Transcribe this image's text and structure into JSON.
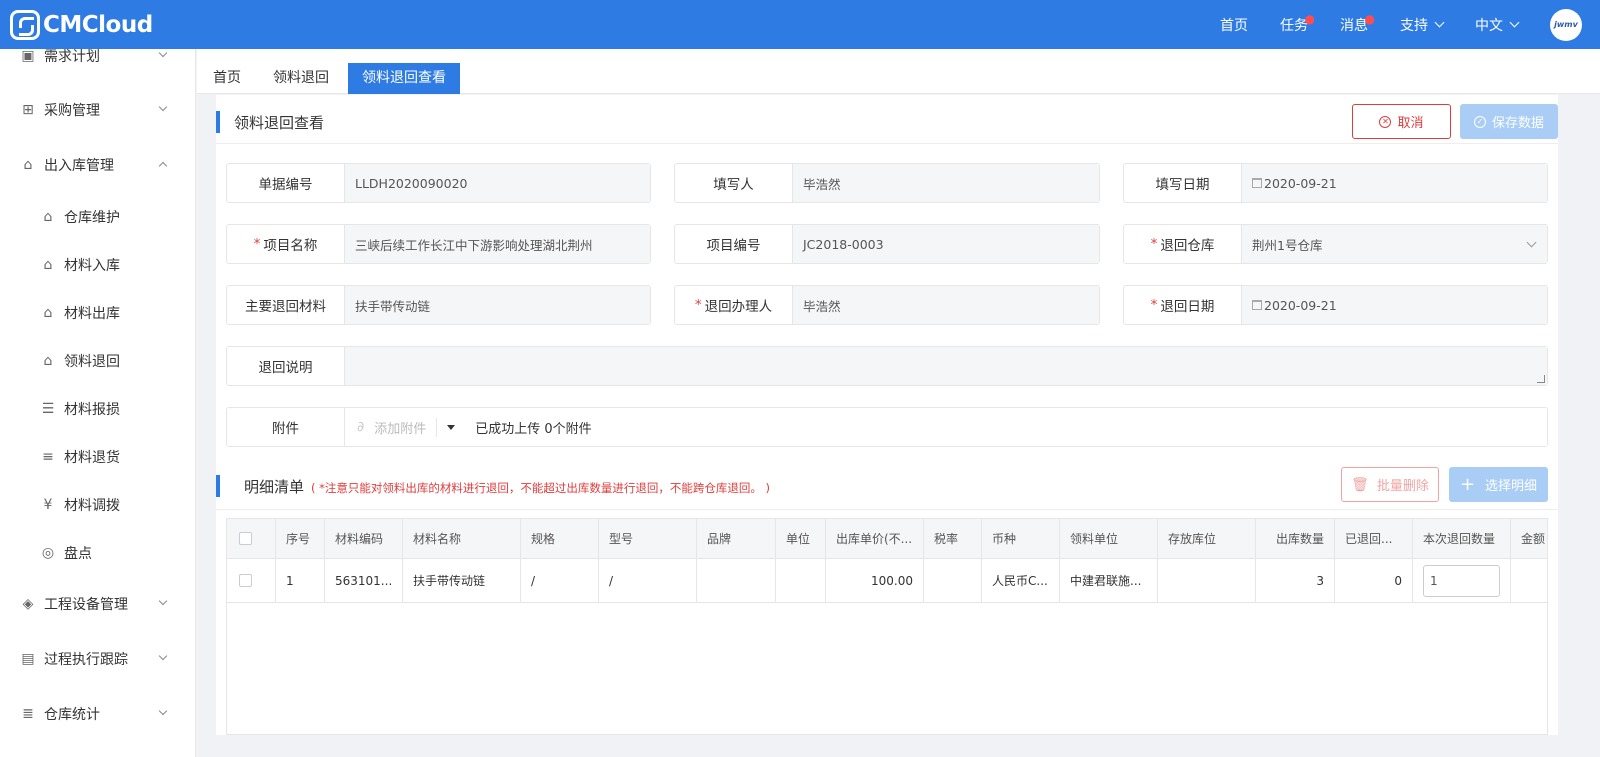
{
  "app": {
    "logo_text": "CMCloud"
  },
  "topnav": {
    "home": "首页",
    "tasks": "任务",
    "messages": "消息",
    "support": "支持",
    "language": "中文",
    "avatar_text": "jwmv"
  },
  "sidebar": {
    "items": [
      {
        "label": "需求计划",
        "icon": "clipboard-icon"
      },
      {
        "label": "采购管理",
        "icon": "org-icon"
      },
      {
        "label": "出入库管理",
        "icon": "warehouse-icon"
      },
      {
        "label": "仓库维护",
        "icon": "house-icon"
      },
      {
        "label": "材料入库",
        "icon": "inbound-icon"
      },
      {
        "label": "材料出库",
        "icon": "outbound-icon"
      },
      {
        "label": "领料退回",
        "icon": "return-icon"
      },
      {
        "label": "材料报损",
        "icon": "document-icon"
      },
      {
        "label": "材料退货",
        "icon": "coins-icon"
      },
      {
        "label": "材料调拨",
        "icon": "transfer-icon"
      },
      {
        "label": "盘点",
        "icon": "database-icon"
      },
      {
        "label": "工程设备管理",
        "icon": "cube-icon"
      },
      {
        "label": "过程执行跟踪",
        "icon": "track-icon"
      },
      {
        "label": "仓库统计",
        "icon": "stats-icon"
      }
    ]
  },
  "tabs": [
    "首页",
    "领料退回",
    "领料退回查看"
  ],
  "panel": {
    "title": "领料退回查看",
    "cancel_label": "取消",
    "save_label": "保存数据"
  },
  "form": {
    "doc_no_label": "单据编号",
    "doc_no": "LLDH2020090020",
    "writer_label": "填写人",
    "writer": "毕浩然",
    "write_date_label": "填写日期",
    "write_date": "2020-09-21",
    "project_name_label": "项目名称",
    "project_name": "三峡后续工作长江中下游影响处理湖北荆州",
    "project_no_label": "项目编号",
    "project_no": "JC2018-0003",
    "return_wh_label": "退回仓库",
    "return_wh": "荆州1号仓库",
    "main_material_label": "主要退回材料",
    "main_material": "扶手带传动链",
    "handler_label": "退回办理人",
    "handler": "毕浩然",
    "return_date_label": "退回日期",
    "return_date": "2020-09-21",
    "remark_label": "退回说明",
    "remark": "",
    "attach_label": "附件",
    "attach_add": "添加附件",
    "attach_status": "已成功上传 0个附件"
  },
  "detail": {
    "title": "明细清单",
    "note": "( *注意只能对领料出库的材料进行退回，不能超过出库数量进行退回，不能跨仓库退回。 )",
    "batch_delete_label": "批量删除",
    "choose_label": "选择明细",
    "columns": [
      "序号",
      "材料编码",
      "材料名称",
      "规格",
      "型号",
      "品牌",
      "单位",
      "出库单价(不...",
      "税率",
      "币种",
      "领料单位",
      "存放库位",
      "出库数量",
      "已退回...",
      "本次退回数量",
      "金额"
    ],
    "rows": [
      [
        "1",
        "563101...",
        "扶手带传动链",
        "/",
        "/",
        "",
        "",
        "100.00",
        "",
        "人民币C...",
        "中建君联施...",
        "",
        "3",
        "0",
        "1",
        ""
      ]
    ]
  }
}
